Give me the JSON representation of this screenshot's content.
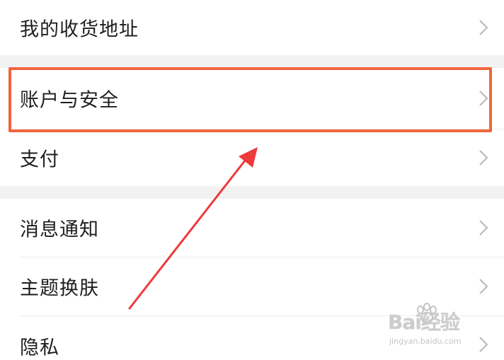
{
  "menu": {
    "items": [
      {
        "label": "我的收货地址"
      },
      {
        "label": "账户与安全"
      },
      {
        "label": "支付"
      },
      {
        "label": "消息通知"
      },
      {
        "label": "主题换肤"
      },
      {
        "label": "隐私"
      }
    ]
  },
  "annotation": {
    "highlight_color": "#f2643d",
    "arrow_color": "#ee3a3a"
  },
  "watermark": {
    "logo_text": "Bai经验",
    "url": "jingyan.baidu.com"
  },
  "icons": {
    "chevron": "chevron-right-icon"
  }
}
